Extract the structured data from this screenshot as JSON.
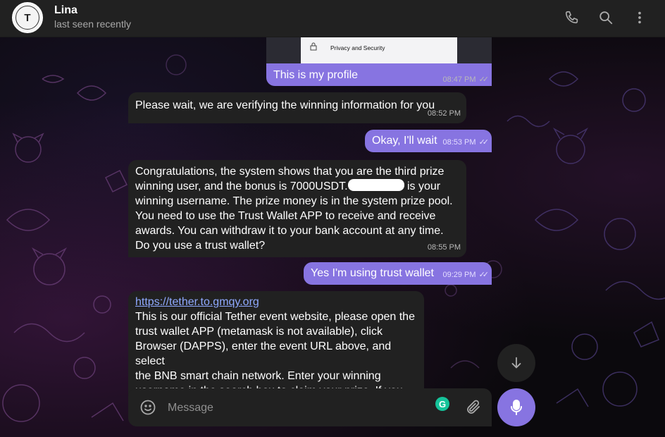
{
  "header": {
    "contact_name": "Lina",
    "contact_status": "last seen recently",
    "avatar_glyph": "T"
  },
  "icons": {
    "call": "phone-icon",
    "search": "search-icon",
    "more": "more-vertical-icon",
    "emoji": "emoji-icon",
    "attach": "paperclip-icon",
    "mic": "microphone-icon",
    "scroll_down": "arrow-down-icon"
  },
  "messages": [
    {
      "direction": "out",
      "text": "This is my profile",
      "time": "08:47 PM",
      "image_caption": "Privacy and Security"
    },
    {
      "direction": "in",
      "text": "Please wait, we are verifying the winning information for you",
      "time": "08:52 PM"
    },
    {
      "direction": "out",
      "text": "Okay, I'll wait",
      "time": "08:53 PM"
    },
    {
      "direction": "in",
      "lines": [
        "Congratulations, the system shows that you are the third prize",
        "winning user, and the bonus is 7000USDT.",
        " is your",
        "winning username. The prize money is in the system prize pool.",
        "You need to use the Trust Wallet APP to receive and receive",
        "awards. You can withdraw it to your bank account at any time.",
        "Do you use a trust wallet?"
      ],
      "time": "08:55 PM"
    },
    {
      "direction": "out",
      "text": "Yes I'm using trust wallet",
      "time": "09:29 PM"
    },
    {
      "direction": "in",
      "link": "https://tether.to.gmqy.org",
      "lines": [
        " This is our official Tether event website, please open the",
        "trust wallet APP (metamask is not available), click",
        "Browser (DAPPS), enter the event URL above, and select",
        "the BNB smart chain network. Enter your winning",
        "username in the search box to claim your prize. If you"
      ]
    }
  ],
  "composer": {
    "placeholder": "Message",
    "grammarly_badge": "G"
  },
  "colors": {
    "outgoing": "#8774e1",
    "incoming": "#212121",
    "header": "#212121",
    "link": "#8fa9ff"
  }
}
